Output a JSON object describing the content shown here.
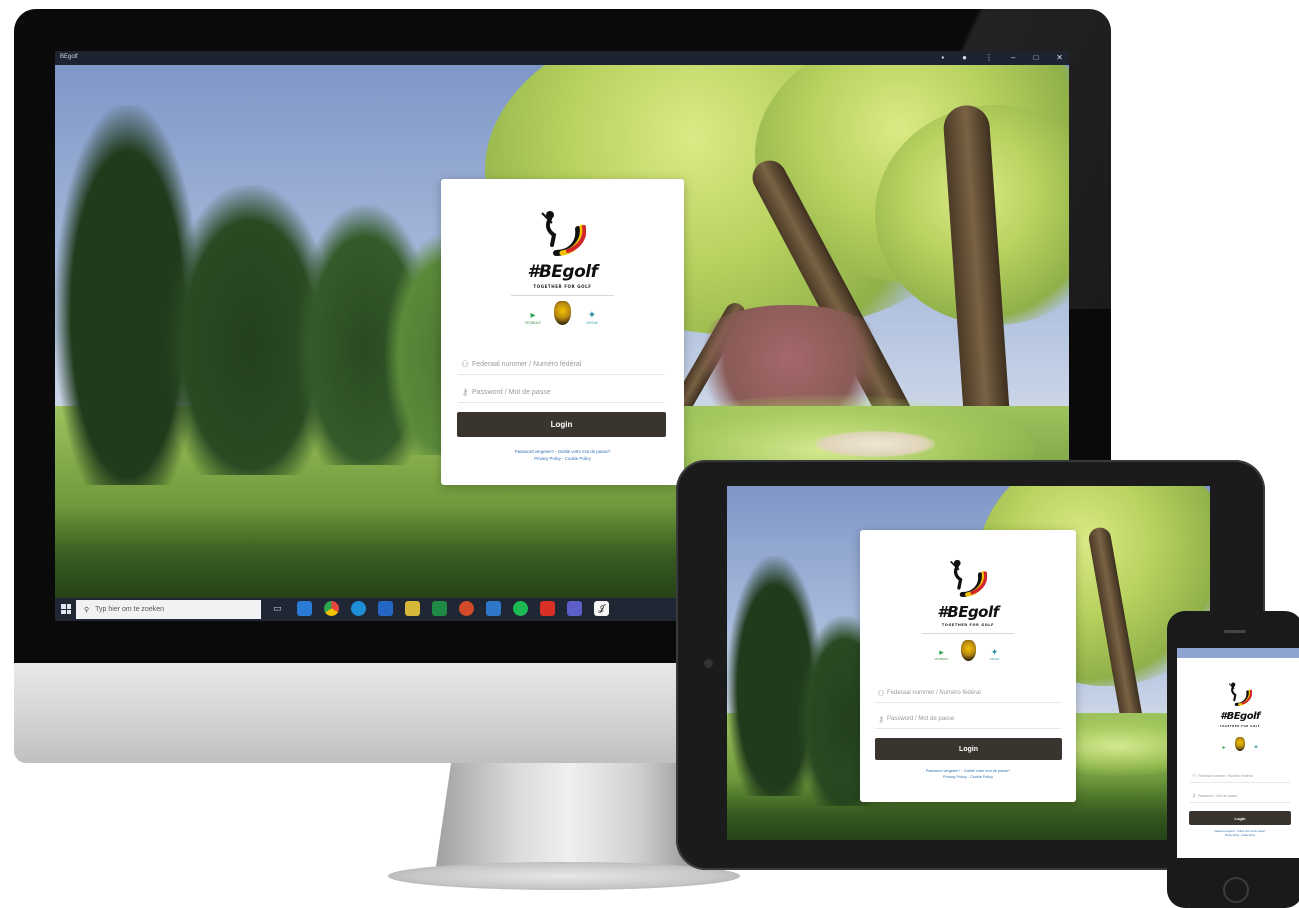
{
  "desktop": {
    "window_title": "BEgolf",
    "window_controls": [
      "‒",
      "□",
      "✕"
    ],
    "taskbar": {
      "search_placeholder": "Typ hier om te zoeken",
      "app_icons": [
        "task-view-icon",
        "vscode-icon",
        "chrome-icon",
        "edge-icon",
        "outlook-icon",
        "files-icon",
        "excel-icon",
        "powerpoint-icon",
        "mail-icon",
        "spotify-icon",
        "acrobat-icon",
        "teams-icon",
        "begolf-app-icon"
      ],
      "app_colors": [
        "#5a6a7e",
        "#2a7bd4",
        "#e8b31c",
        "#1e8fd6",
        "#2566c4",
        "#d6b73a",
        "#1f8a45",
        "#d24a2a",
        "#2f78c9",
        "#1db954",
        "#d93025",
        "#5b5fc7",
        "#f5f5f5"
      ]
    }
  },
  "login": {
    "brand": "#BEgolf",
    "tagline": "TOGETHER FOR GOLF",
    "partners": [
      "VFGBOLF",
      "crest",
      "AFGolf"
    ],
    "federal_number_placeholder": "Federaal nummer / Numéro fédéral",
    "password_placeholder": "Password / Mot de passe",
    "login_label": "Login",
    "forgot_password_link": "Password vergeten? - Oublié votre mot de passe?",
    "policy_links": "Privacy Policy - Cookie Policy"
  },
  "colors": {
    "button": "#3a342e",
    "link": "#2f6fb3",
    "flag_black": "#111111",
    "flag_yellow": "#f2c200",
    "flag_red": "#d1242b"
  }
}
